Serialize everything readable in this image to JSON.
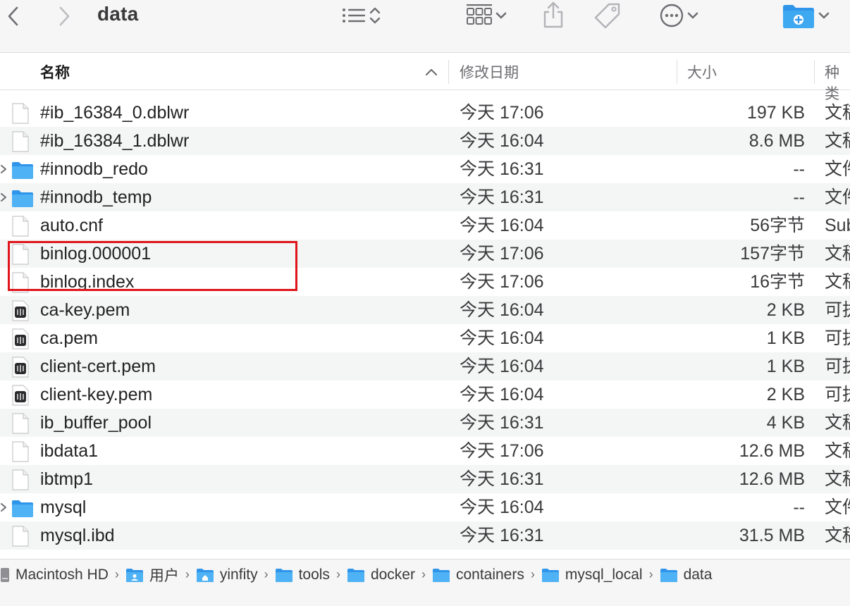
{
  "window": {
    "title": "data"
  },
  "toolbar": {
    "back_icon": "chevron-left-icon",
    "forward_icon": "chevron-right-icon",
    "view_list_icon": "list-view-icon",
    "group_icon": "grid-group-icon",
    "share_icon": "share-icon",
    "tag_icon": "tag-icon",
    "more_icon": "ellipsis-circle-icon",
    "new_folder_icon": "new-folder-icon"
  },
  "columns": {
    "name": "名称",
    "date": "修改日期",
    "size": "大小",
    "kind": "种类"
  },
  "files": [
    {
      "name": "#ib_16384_0.dblwr",
      "date": "今天 17:06",
      "size": "197 KB",
      "kind": "文稿",
      "icon": "document-icon"
    },
    {
      "name": "#ib_16384_1.dblwr",
      "date": "今天 16:04",
      "size": "8.6 MB",
      "kind": "文稿",
      "icon": "document-icon"
    },
    {
      "name": "#innodb_redo",
      "date": "今天 16:31",
      "size": "--",
      "kind": "文件夹",
      "icon": "folder-icon"
    },
    {
      "name": "#innodb_temp",
      "date": "今天 16:31",
      "size": "--",
      "kind": "文件夹",
      "icon": "folder-icon"
    },
    {
      "name": "auto.cnf",
      "date": "今天 16:04",
      "size": "56字节",
      "kind": "Sublime",
      "icon": "document-icon"
    },
    {
      "name": "binlog.000001",
      "date": "今天 17:06",
      "size": "157字节",
      "kind": "文稿",
      "icon": "document-icon"
    },
    {
      "name": "binlog.index",
      "date": "今天 17:06",
      "size": "16字节",
      "kind": "文稿",
      "icon": "document-icon"
    },
    {
      "name": "ca-key.pem",
      "date": "今天 16:04",
      "size": "2 KB",
      "kind": "可执行",
      "icon": "terminal-icon"
    },
    {
      "name": "ca.pem",
      "date": "今天 16:04",
      "size": "1 KB",
      "kind": "可执行",
      "icon": "terminal-icon"
    },
    {
      "name": "client-cert.pem",
      "date": "今天 16:04",
      "size": "1 KB",
      "kind": "可执行",
      "icon": "terminal-icon"
    },
    {
      "name": "client-key.pem",
      "date": "今天 16:04",
      "size": "2 KB",
      "kind": "可执行",
      "icon": "terminal-icon"
    },
    {
      "name": "ib_buffer_pool",
      "date": "今天 16:31",
      "size": "4 KB",
      "kind": "文稿",
      "icon": "document-icon"
    },
    {
      "name": "ibdata1",
      "date": "今天 17:06",
      "size": "12.6 MB",
      "kind": "文稿",
      "icon": "document-icon"
    },
    {
      "name": "ibtmp1",
      "date": "今天 16:31",
      "size": "12.6 MB",
      "kind": "文稿",
      "icon": "document-icon"
    },
    {
      "name": "mysql",
      "date": "今天 16:04",
      "size": "--",
      "kind": "文件夹",
      "icon": "folder-icon"
    },
    {
      "name": "mysql.ibd",
      "date": "今天 16:31",
      "size": "31.5 MB",
      "kind": "文稿",
      "icon": "document-icon"
    }
  ],
  "path": [
    "Macintosh HD",
    "用户",
    "yinfity",
    "tools",
    "docker",
    "containers",
    "mysql_local",
    "data"
  ],
  "colors": {
    "accent_folder": "#3ea8f0",
    "highlight": "#e0151b",
    "alt_row": "#f4f5f5"
  }
}
